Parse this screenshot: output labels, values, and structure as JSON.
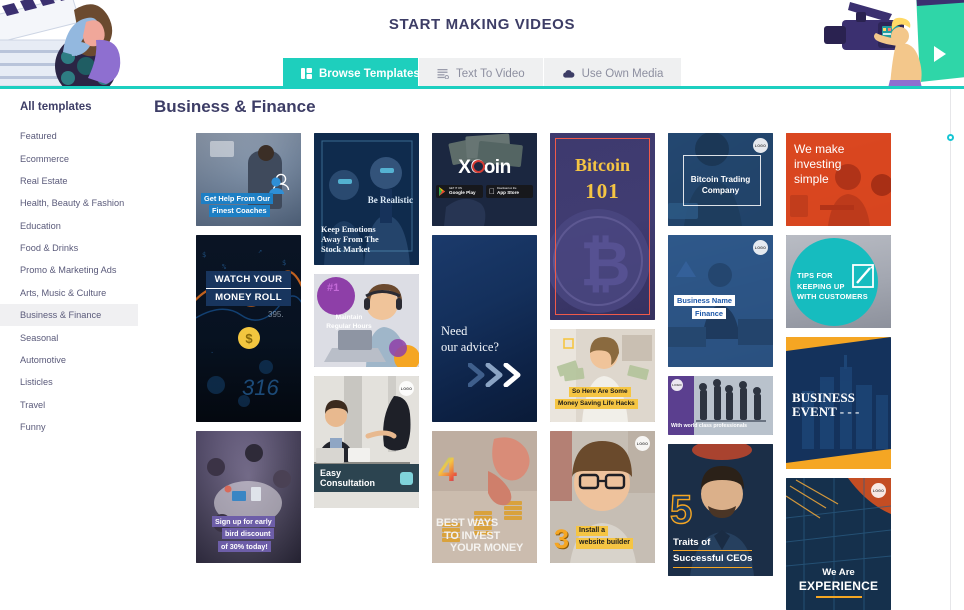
{
  "header": {
    "title": "START MAKING VIDEOS",
    "tabs": [
      {
        "label": "Browse Templates",
        "icon": "templates-grid-icon",
        "active": true
      },
      {
        "label": "Text To Video",
        "icon": "text-lines-icon",
        "active": false
      },
      {
        "label": "Use Own Media",
        "icon": "cloud-upload-icon",
        "active": false
      }
    ],
    "accent_color": "#1ecfbd",
    "title_color": "#3d3d66"
  },
  "sidebar": {
    "heading": "All templates",
    "items": [
      {
        "label": "Featured"
      },
      {
        "label": "Ecommerce"
      },
      {
        "label": "Real Estate"
      },
      {
        "label": "Health, Beauty & Fashion"
      },
      {
        "label": "Education"
      },
      {
        "label": "Food & Drinks"
      },
      {
        "label": "Promo & Marketing Ads"
      },
      {
        "label": "Arts, Music & Culture"
      },
      {
        "label": "Business & Finance"
      },
      {
        "label": "Seasonal"
      },
      {
        "label": "Automotive"
      },
      {
        "label": "Listicles"
      },
      {
        "label": "Travel"
      },
      {
        "label": "Funny"
      }
    ],
    "active_index": 8
  },
  "main": {
    "title": "Business & Finance"
  },
  "templates": {
    "col1": [
      {
        "id": "get-help-coaches",
        "lines": [
          "Get Help From Our",
          "Finest Coaches"
        ],
        "shape": "sq"
      },
      {
        "id": "watch-money-roll",
        "lines": [
          "WATCH YOUR",
          "MONEY ROLL"
        ],
        "extra": "$",
        "shape": "st"
      },
      {
        "id": "early-bird-discount",
        "lines": [
          "Sign up for early",
          "bird discount",
          "of 30% today!"
        ],
        "shape": "pt"
      }
    ],
    "col2": [
      {
        "id": "be-realistic",
        "heading": "Be Realistic",
        "lines": [
          "Keep Emotions",
          "Away From The",
          "Stock Market"
        ],
        "shape": "pt"
      },
      {
        "id": "maintain-regular-hours",
        "badge": "#1",
        "lines": [
          "Maintain",
          "Regular Hours"
        ],
        "shape": "sq"
      },
      {
        "id": "easy-consultation",
        "lines": [
          "Easy Consultation"
        ],
        "logo": "LOGO",
        "shape": "pt"
      }
    ],
    "col3": [
      {
        "id": "xcoin",
        "heading": "XCoin",
        "stores": [
          "Google Play",
          "App Store"
        ],
        "store_sub": [
          "GET IT ON",
          "Download on the"
        ],
        "shape": "sq"
      },
      {
        "id": "need-our-advice",
        "lines": [
          "Need",
          "our advice?"
        ],
        "shape": "st"
      },
      {
        "id": "best-ways-invest",
        "number": "4",
        "lines": [
          "BEST WAYS",
          "TO INVEST",
          "YOUR MONEY"
        ],
        "shape": "pt"
      }
    ],
    "col4": [
      {
        "id": "bitcoin-101",
        "lines": [
          "Bitcoin",
          "101"
        ],
        "shape": "st"
      },
      {
        "id": "money-saving-hacks",
        "lines": [
          "So Here Are Some",
          "Money Saving Life Hacks"
        ],
        "shape": "sq"
      },
      {
        "id": "install-website-builder",
        "number": "3",
        "lines": [
          "Install a",
          "website builder"
        ],
        "logo": "LOGO",
        "shape": "pt"
      }
    ],
    "col5": [
      {
        "id": "bitcoin-trading-company",
        "lines": [
          "Bitcoin Trading",
          "Company"
        ],
        "logo": "LOGO",
        "shape": "sq"
      },
      {
        "id": "business-name-finance",
        "lines": [
          "Business Name",
          "Finance"
        ],
        "logo": "LOGO",
        "shape": "pt"
      },
      {
        "id": "world-class-professionals",
        "lines": [
          "With world class professionals"
        ],
        "logo": "LOGO",
        "shape": "ls"
      },
      {
        "id": "traits-successful-ceos",
        "number": "5",
        "lines": [
          "Traits of",
          "Successful CEOs"
        ],
        "shape": "pt"
      }
    ],
    "col6": [
      {
        "id": "we-make-investing-simple",
        "lines": [
          "We make",
          "investing",
          "simple"
        ],
        "shape": "sq"
      },
      {
        "id": "tips-keeping-up-customers",
        "lines": [
          "TIPS FOR",
          "KEEPING UP",
          "WITH CUSTOMERS"
        ],
        "shape": "sq"
      },
      {
        "id": "business-event",
        "lines": [
          "BUSINESS",
          "EVENT - - -"
        ],
        "shape": "pt"
      },
      {
        "id": "we-are-experience",
        "lines": [
          "We Are",
          "EXPERIENCE"
        ],
        "logo": "LOGO",
        "shape": "pt"
      }
    ]
  }
}
